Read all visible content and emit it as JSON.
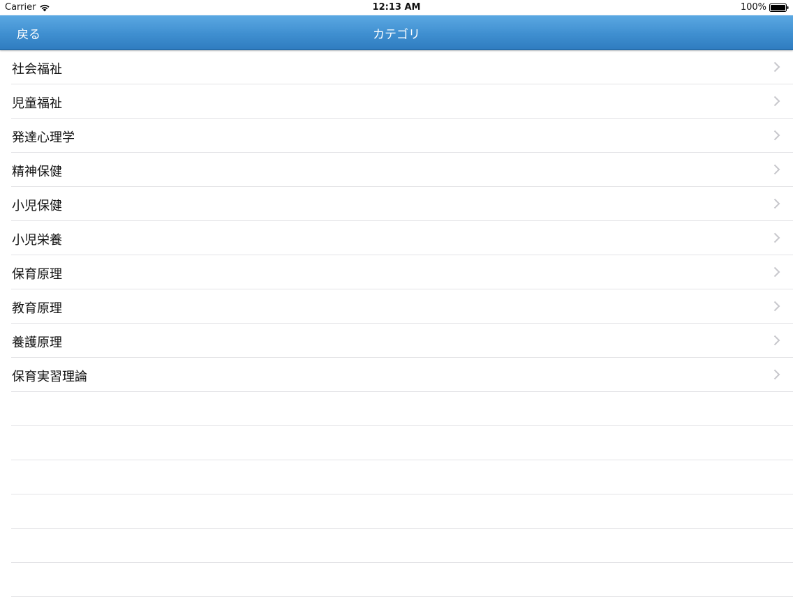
{
  "status_bar": {
    "carrier": "Carrier",
    "time": "12:13 AM",
    "battery": "100%"
  },
  "nav_bar": {
    "back_label": "戻る",
    "title": "カテゴリ"
  },
  "categories": [
    {
      "label": "社会福祉"
    },
    {
      "label": "児童福祉"
    },
    {
      "label": "発達心理学"
    },
    {
      "label": "精神保健"
    },
    {
      "label": "小児保健"
    },
    {
      "label": "小児栄養"
    },
    {
      "label": "保育原理"
    },
    {
      "label": "教育原理"
    },
    {
      "label": "養護原理"
    },
    {
      "label": "保育実習理論"
    }
  ],
  "icons": {
    "row_accessory": "chevron-right-icon",
    "wifi": "wifi-icon",
    "battery": "battery-icon"
  },
  "colors": {
    "nav_bar_top": "#5ba8e2",
    "nav_bar_bottom": "#2f7cc0",
    "separator": "#e3e3e6",
    "chevron": "#c7c7cc"
  }
}
